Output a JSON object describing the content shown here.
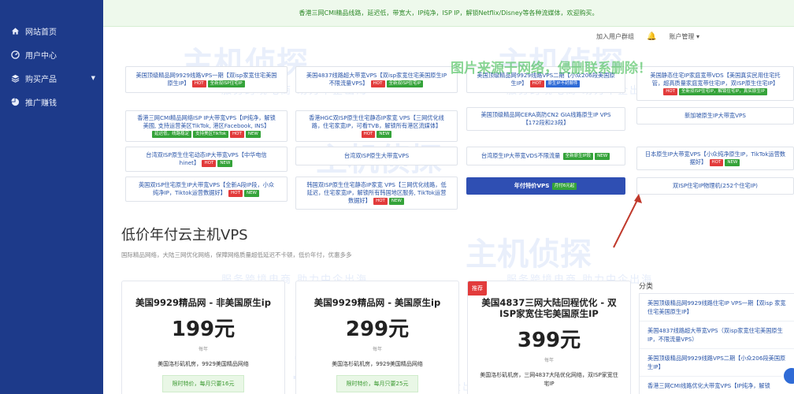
{
  "sidebar": {
    "items": [
      {
        "label": "网站首页",
        "icon": "home-icon"
      },
      {
        "label": "用户中心",
        "icon": "dashboard-icon"
      },
      {
        "label": "购买产品",
        "icon": "layers-icon",
        "has_caret": true
      },
      {
        "label": "推广赚钱",
        "icon": "pie-chart-icon"
      }
    ]
  },
  "banner": {
    "text": "香港三网CMI精品线路，延迟低，带宽大，IP纯净，ISP IP，解锁Netflix/Disney等各种流媒体，欢迎购买。"
  },
  "topbar": {
    "add_favorite": "加入用户群组",
    "account": "账户管理"
  },
  "products": {
    "c1": {
      "l1": "美国顶级精品网9929线路VPS一期【双isp家宽住宅美国",
      "l2": "原生IP】",
      "tags": [
        "HOT",
        "全新双ISP住宅IP"
      ]
    },
    "c2": {
      "l1": "美国4837线路超大带宽VPS【双isp家宽住宅美国原生IP",
      "l2": "不限流量VPS】",
      "tags": [
        "HOT",
        "全新双ISP住宅IP"
      ]
    },
    "c3": {
      "l1": "美国顶级精品网9929线路VPS二期【小众206段美国原",
      "l2": "生IP】",
      "tags": [
        "HOT",
        "原生IP不封邮件"
      ]
    },
    "c4": {
      "l1": "美国静态住宅IP家庭宽带VDS【美国真实民用住宅托",
      "l2": "管，超高质量家庭宽带住宅IP，双ISP原生住宅IP】",
      "tags": [
        "HOT",
        "全新双ISP住宅IP，解锁住宅IP，真实原生IP"
      ]
    },
    "c5": {
      "l1": "香港三网CMI精品网络ISP IP大带宽VPS【IP纯净，解锁",
      "l2": "美國, 支持运营美区TikTok, 港区Facebook, INS】",
      "tags": [
        "延迟低，线路稳定",
        "支持美区TikTok",
        "HOT",
        "NEW"
      ]
    },
    "c6": {
      "l1": "香港HGC双ISP原生住宅静态IP家宽 VPS【三网优化线",
      "l2": "路，住宅家宽IP，可看TVB，解锁所有港区流媒体】",
      "tags": [
        "HOT",
        "NEW"
      ]
    },
    "c7": {
      "l1": "美国顶级精品网CERA高防CN2 GIA线路原生IP VPS",
      "l2": "【172段和23段】",
      "tags": []
    },
    "c8": {
      "l1": "新加坡原生IP大带宽VPS",
      "l2": "",
      "tags": []
    },
    "c9": {
      "l1": "台湾双ISP原生住宅动态IP大带宽VPS【中华电信",
      "l2": "hinet】",
      "tags": [
        "HOT",
        "NEW"
      ]
    },
    "c10": {
      "l1": "台湾双ISP原生大带宽VPS",
      "l2": "",
      "tags": []
    },
    "c11": {
      "l1": "台湾原生IP大带宽VDS不限流量",
      "l2": "",
      "tags": [
        "全新原生IP段",
        "NEW"
      ]
    },
    "c12": {
      "l1": "日本原生IP大带宽VPS【小众纯净原生IP，TikTok运营数",
      "l2": "据好】",
      "tags": [
        "HOT",
        "NEW"
      ]
    },
    "c13": {
      "l1": "英国双ISP住宅原生IP大带宽VPS【全新A段IP段，小众",
      "l2": "纯净IP，Tiktok运营数据好】",
      "tags": [
        "HOT",
        "NEW"
      ]
    },
    "c14": {
      "l1": "韩国双ISP原生住宅静态IP家宽 VPS【三网优化线路，低",
      "l2": "延迟，住宅家宽IP，解锁所有韩国地区服务, TikTok运营",
      "l3": "数据好】",
      "tags": [
        "HOT",
        "NEW"
      ]
    },
    "c15": {
      "l1": "年付特价VPS",
      "tags": [
        "月付6元起"
      ]
    },
    "c16": {
      "l1": "双ISP住宅IP物理机(252个住宅IP)"
    }
  },
  "section": {
    "title": "低价年付云主机VPS",
    "subtitle": "国际精品网络，大陆三网优化网络，保障网络质量超低延迟不卡顿，低价年付，优惠多多"
  },
  "plans": [
    {
      "name": "美国9929精品网 - 非美国原生ip",
      "price": "199元",
      "per": "每年",
      "desc": "美国洛杉矶机房，9929美国精品网络",
      "promo": "限时特价，每月只要16元"
    },
    {
      "name": "美国9929精品网 - 美国原生ip",
      "price": "299元",
      "per": "每年",
      "desc": "美国洛杉矶机房，9929美国精品网络",
      "promo": "限时特价，每月只要25元"
    },
    {
      "name": "美国4837三网大陆回程优化 - 双ISP家宽住宅美国原生IP",
      "price": "399元",
      "per": "每年",
      "desc": "美国洛杉矶机房，三网4837大陆优化网络，双ISP家宽住宅IP",
      "badge": "推荐"
    }
  ],
  "category": {
    "title": "分类",
    "items": [
      "美国顶级精品网9929线路住宅IP VPS一期【双isp 家宽住宅美国原生IP】",
      "美国4837线路超大带宽VPS（双isp家宽住宅美国原生IP，不限流量VPS）",
      "美国顶级精品网9929线路VPS二期【小众206段美国原生IP】",
      "香港三网CMI线路优化大带宽VPS【IP纯净，解锁"
    ]
  },
  "watermark": {
    "brand": "主机侦探",
    "slogan": "服务跨境电商 助力中企出海"
  },
  "overlay_note": "图片来源于网络，侵删联系删除！",
  "colors": {
    "sidebar": "#1d3a8a",
    "accent": "#2f4fb3",
    "hot": "#e23b3b",
    "new": "#35a33a"
  }
}
